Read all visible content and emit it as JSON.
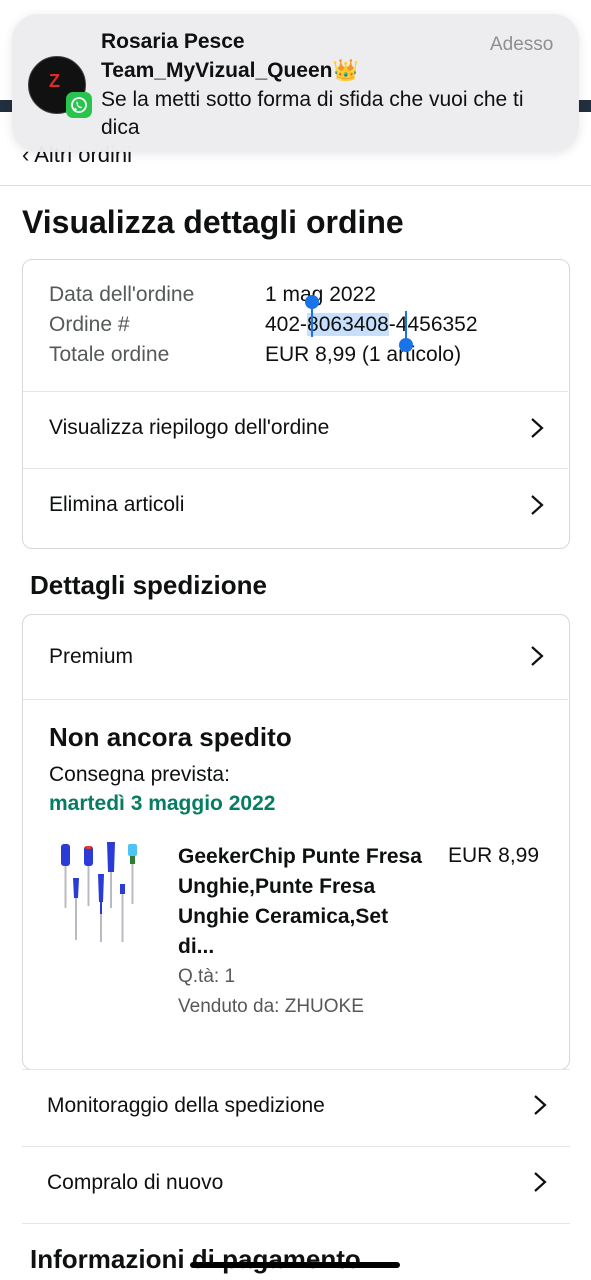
{
  "notification": {
    "sender": "Rosaria Pesce",
    "group": "Team_MyVizual_Queen👑",
    "time": "Adesso",
    "message": "Se la metti sotto forma di sfida che vuoi che ti dica",
    "app_icon": "whatsapp-icon"
  },
  "header": {
    "back_label": "‹ Altri ordini"
  },
  "page": {
    "title": "Visualizza dettagli ordine"
  },
  "order_summary": {
    "date_label": "Data dell'ordine",
    "date_value": "1 mag 2022",
    "number_label": "Ordine #",
    "number_prefix": "402-",
    "number_selected": "8063408",
    "number_suffix": "-4456352",
    "total_label": "Totale ordine",
    "total_value": "EUR 8,99 (1 articolo)",
    "links": [
      {
        "label": "Visualizza riepilogo dell'ordine"
      },
      {
        "label": "Elimina articoli"
      }
    ]
  },
  "shipment": {
    "section_title": "Dettagli spedizione",
    "method": "Premium",
    "status": "Non ancora spedito",
    "delivery_label": "Consegna prevista:",
    "delivery_date": "martedì 3 maggio 2022",
    "product": {
      "title": "GeekerChip Punte Fresa Unghie,Punte Fresa Unghie Ceramica,Set di...",
      "price": "EUR 8,99",
      "qty": "Q.tà: 1",
      "seller": "Venduto da: ZHUOKE"
    },
    "actions": [
      {
        "label": "Monitoraggio della spedizione"
      },
      {
        "label": "Compralo di nuovo"
      }
    ]
  },
  "payment": {
    "section_title": "Informazioni di pagamento"
  },
  "colors": {
    "accent_green": "#067d62",
    "selection": "#c7dffa",
    "selection_handle": "#1a73e8",
    "whatsapp": "#28c44e"
  }
}
